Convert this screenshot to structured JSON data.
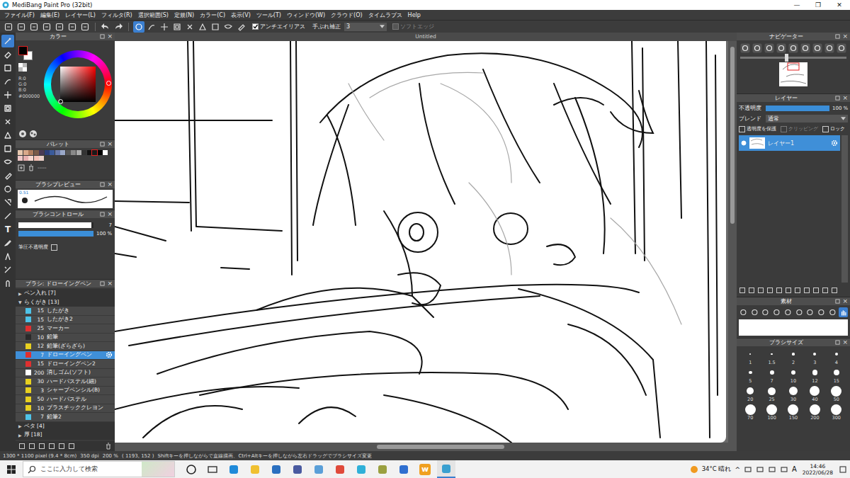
{
  "window": {
    "title": "MediBang Paint Pro (32bit)",
    "controls": [
      "—",
      "❐",
      "✕"
    ]
  },
  "menu": [
    "ファイル(F)",
    "編集(E)",
    "レイヤー(L)",
    "フィルタ(R)",
    "選択範囲(S)",
    "定規(N)",
    "カラー(C)",
    "表示(V)",
    "ツール(T)",
    "ウィンドウ(W)",
    "クラウド(O)",
    "タイムラプス",
    "Help"
  ],
  "toolbar": {
    "mode_buttons": [
      {
        "selected": true
      },
      {
        "selected": false
      },
      {
        "selected": false
      },
      {
        "selected": false
      },
      {
        "selected": false
      },
      {
        "selected": false
      },
      {
        "selected": false
      },
      {
        "selected": false
      },
      {
        "selected": false
      }
    ],
    "antialias": {
      "label": "アンチエイリアス",
      "checked": true
    },
    "stabilizer": {
      "label": "手ぶれ補正",
      "value": "3"
    },
    "soft_edge": {
      "label": "ソフトエッジ",
      "checked": false,
      "disabled": true
    }
  },
  "tools": [
    {
      "selected": true
    },
    {
      "selected": false
    },
    {
      "selected": false
    },
    {
      "selected": false
    },
    {
      "selected": false
    },
    {
      "selected": false
    },
    {
      "selected": false
    },
    {
      "selected": false
    },
    {
      "selected": false
    },
    {
      "selected": false
    },
    {
      "selected": false
    },
    {
      "selected": false
    },
    {
      "selected": false
    },
    {
      "selected": false
    },
    {
      "selected": false,
      "glyph": "T"
    },
    {
      "selected": false
    },
    {
      "selected": false
    },
    {
      "selected": false
    },
    {
      "selected": false
    }
  ],
  "panel_close": "×",
  "color_panel": {
    "title": "カラー",
    "foreground": "#000000",
    "background": "#ffffff",
    "r": "R:0",
    "g": "G:0",
    "b": "B:0",
    "hex": "#000000"
  },
  "palette": {
    "title": "パレット",
    "name": "-----",
    "swatches": [
      {
        "color": "#e8c9b0",
        "selected": false
      },
      {
        "color": "#d9a98a",
        "selected": false
      },
      {
        "color": "#b07d5e",
        "selected": false
      },
      {
        "color": "#7a5a48",
        "selected": false
      },
      {
        "color": "#4a3a55",
        "selected": false
      },
      {
        "color": "#2c3e7a",
        "selected": false
      },
      {
        "color": "#3a5a9a",
        "selected": false
      },
      {
        "color": "#6a7aaa",
        "selected": false
      },
      {
        "color": "#9aa8c8",
        "selected": false
      },
      {
        "color": "#555555",
        "selected": false
      },
      {
        "color": "#888888",
        "selected": false
      },
      {
        "color": "#aaaaaa",
        "selected": false
      },
      {
        "color": "#333333",
        "selected": false
      },
      {
        "color": "#111111",
        "selected": false
      },
      {
        "color": "#1a1a1a",
        "selected": true
      },
      {
        "color": "#000000",
        "selected": false
      },
      {
        "color": "#ffffff",
        "selected": false
      },
      {
        "color": "#f0c8c8",
        "selected": false
      },
      {
        "color": "#e8b0b0",
        "selected": false
      },
      {
        "color": "#f8d8d0",
        "selected": false
      },
      {
        "color": "#f5c0b5",
        "selected": false
      },
      {
        "color": "#ecd0c8",
        "selected": false
      }
    ]
  },
  "brush_preview": {
    "title": "ブラシプレビュー",
    "scale": "0.51"
  },
  "brush_control": {
    "title": "ブラシコントロール",
    "size": {
      "value": "7",
      "level": 0.97
    },
    "opacity": {
      "value": "100 %",
      "level": 1
    },
    "pressure": {
      "label": "筆圧不透明度",
      "checked": false
    }
  },
  "brushes": {
    "title": "ブラシ: ドローイングペン",
    "groups": [
      {
        "name": "ペン入れ [7]",
        "arrow": "▶",
        "expanded": false,
        "items": []
      },
      {
        "name": "らくがき [13]",
        "arrow": "▼",
        "expanded": true,
        "items": [
          {
            "size": "15",
            "name": "したがき",
            "color": "#4fc3e8",
            "selected": false
          },
          {
            "size": "15",
            "name": "したがき2",
            "color": "#4fc3e8",
            "selected": false
          },
          {
            "size": "25",
            "name": "マーカー",
            "color": "#e03030",
            "selected": false
          },
          {
            "size": "10",
            "name": "鉛筆",
            "color": "#2a2a2a",
            "selected": false
          },
          {
            "size": "12",
            "name": "鉛筆(ざらざら)",
            "color": "#e8d020",
            "selected": false
          },
          {
            "size": "7",
            "name": "ドローイングペン",
            "color": "#e03030",
            "selected": true
          },
          {
            "size": "15",
            "name": "ドローイングペン2",
            "color": "#e03030",
            "selected": false
          },
          {
            "size": "200",
            "name": "消しゴム(ソフト)",
            "color": "#ffffff",
            "selected": false
          },
          {
            "size": "30",
            "name": "ハードパステル(細)",
            "color": "#e8d020",
            "selected": false
          },
          {
            "size": "3",
            "name": "シャープペンシル(B)",
            "color": "#e8d020",
            "selected": false
          },
          {
            "size": "50",
            "name": "ハードパステル",
            "color": "#e8d020",
            "selected": false
          },
          {
            "size": "10",
            "name": "プラスチッククレヨン",
            "color": "#e8d020",
            "selected": false
          },
          {
            "size": "7",
            "name": "鉛筆2",
            "color": "#4fc3e8",
            "selected": false
          }
        ]
      },
      {
        "name": "ベタ [4]",
        "arrow": "▶",
        "expanded": false,
        "items": []
      },
      {
        "name": "厚 [18]",
        "arrow": "▶",
        "expanded": false,
        "items": []
      }
    ]
  },
  "canvas": {
    "tab": "Untitled"
  },
  "navigator": {
    "title": "ナビゲーター",
    "zoom_level": 0.43
  },
  "layers": {
    "title": "レイヤー",
    "opacity_label": "不透明度",
    "opacity_value": "100 %",
    "opacity_level": 1,
    "blend_label": "ブレンド",
    "blend_value": "通常",
    "options": [
      {
        "label": "透明度を保護",
        "checked": false,
        "disabled": false
      },
      {
        "label": "クリッピング",
        "checked": false,
        "disabled": true
      },
      {
        "label": "ロック",
        "checked": false,
        "disabled": false
      }
    ],
    "items": [
      {
        "name": "レイヤー1",
        "selected": true,
        "visible": true
      }
    ]
  },
  "materials": {
    "title": "素材"
  },
  "brush_size": {
    "title": "ブラシサイズ",
    "sizes": [
      "1",
      "1.5",
      "2",
      "3",
      "4",
      "5",
      "7",
      "10",
      "12",
      "15",
      "20",
      "25",
      "30",
      "40",
      "50",
      "70",
      "100",
      "150",
      "200",
      "300"
    ]
  },
  "status_bar": [
    "1300 * 1100 pixel (9.4 * 8cm)",
    "350 dpi",
    "200 %",
    "( 1193, 152 )",
    "Shiftキーを押しながらで直線描画、Ctrl+Altキーを押しながら左右ドラッグでブラシサイズ変更"
  ],
  "taskbar": {
    "search_placeholder": "ここに入力して検索",
    "apps": [
      {
        "color": "#222222",
        "active": false
      },
      {
        "color": "#333333",
        "active": false
      },
      {
        "color": "#1f8ad9",
        "active": false
      },
      {
        "color": "#f0c030",
        "active": false
      },
      {
        "color": "#2a6fc0",
        "active": false
      },
      {
        "color": "#4a5aa0",
        "active": false
      },
      {
        "color": "#5a9fd8",
        "active": false
      },
      {
        "color": "#e04a3a",
        "active": false
      },
      {
        "color": "#2fb0d8",
        "active": false
      },
      {
        "color": "#9aa040",
        "active": false
      },
      {
        "color": "#2f6fd0",
        "active": false
      },
      {
        "color": "#f0a020",
        "active": false,
        "glyph": "w"
      },
      {
        "color": "#3aa0d0",
        "active": true
      }
    ],
    "weather": "34°C 晴れ",
    "tray_arrow": "^",
    "ime": "A",
    "time": "14:46",
    "date": "2022/06/28"
  }
}
